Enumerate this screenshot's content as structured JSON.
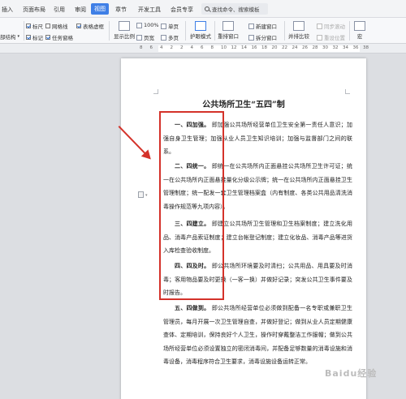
{
  "menu": {
    "tabs": [
      "插入",
      "页面布局",
      "引用",
      "审阅",
      "视图",
      "章节",
      "开发工具",
      "会员专享"
    ],
    "active_tab": "视图",
    "search": "查找命令、搜索模板"
  },
  "ribbon": {
    "doc_structure": "部结构",
    "checks": [
      {
        "label": "标尺",
        "checked": true
      },
      {
        "label": "网格线",
        "checked": false
      },
      {
        "label": "表格虚框",
        "checked": true
      },
      {
        "label": "标记",
        "checked": true
      },
      {
        "label": "任务窗格",
        "checked": true
      }
    ],
    "show_ratio": "显示比例",
    "zoom_100": "100%",
    "page_width": "页宽",
    "single_page": "单页",
    "multi_page": "多页",
    "eye_mode": "护眼模式",
    "rearrange": "重排窗口",
    "new_window": "新建窗口",
    "split_window": "拆分窗口",
    "side_by_side": "并排比较",
    "sync_scroll": "同步滚动",
    "reset_position": "重设位置",
    "more": "宏"
  },
  "ruler": {
    "numbers": [
      "8",
      "6",
      "4",
      "2",
      "2",
      "4",
      "6",
      "8",
      "10",
      "12",
      "14",
      "16",
      "18",
      "20",
      "22",
      "24",
      "26",
      "28",
      "30",
      "32",
      "34",
      "36",
      "38"
    ]
  },
  "document": {
    "title": "公共场所卫生“五四”制",
    "paragraphs": [
      {
        "lead": "一、四加强。",
        "text": "即加强公共场所经营单位卫生安全第一责任人意识；加强自身卫生管理；加强从业人员卫生知识培训；加强与监督部门之间的联系。"
      },
      {
        "lead": "二、四统一。",
        "text": "即统一在公共场所内正面悬挂公共场所卫生许可证；统一在公共场所内正面悬挂量化分级公示牌；统一在公共场所内正面悬挂卫生管理制度；统一配发一套卫生管理档案盒（内有制度、各类公共用品清洗消毒操作规范等九项内容）。"
      },
      {
        "lead": "三、四建立。",
        "text": "即建立公共场所卫生管理和卫生档案制度；建立洗化用品、消毒产品索证制度；建立台帐登记制度；建立化妆品、消毒产品等进货入库检查验收制度。"
      },
      {
        "lead": "四、四及时。",
        "text": "即公共场所环境要及时清扫；公共用品、用具要及时消毒；客用物品要及时更换（一客一换）并做好记录；突发公共卫生事件要及时报告。"
      },
      {
        "lead": "五、四做到。",
        "text": "即公共场所经营单位必须做到配备一名专职或兼职卫生管理员，每月开展一次卫生管理自查，并做好登记；做到从业人员定期健康查体、定期培训，保持良好个人卫生，操作时穿戴整洁工作服帽；做到公共场所经营单位必须设置独立的密闭消毒间，并配备足够数量的消毒设施和消毒设备，消毒程序符合卫生要求，消毒设施设备运转正常。"
      }
    ]
  },
  "watermark": "Baidu经验",
  "colors": {
    "accent": "#3f7fe6",
    "annotation": "#d4322a"
  }
}
